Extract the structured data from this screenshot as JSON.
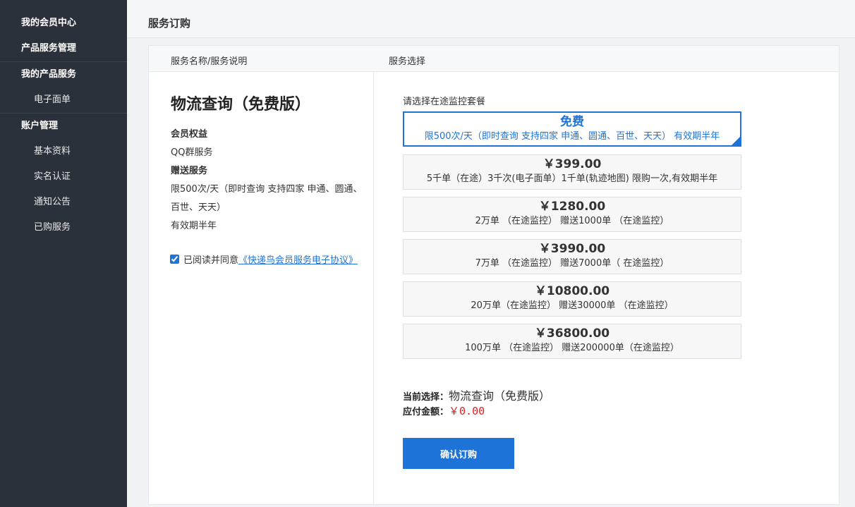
{
  "sidebar": {
    "items": [
      {
        "label": "我的会员中心",
        "level": "top"
      },
      {
        "label": "产品服务管理",
        "level": "top"
      },
      {
        "label": "我的产品服务",
        "level": "top"
      },
      {
        "label": "电子面单",
        "level": "sub"
      },
      {
        "label": "账户管理",
        "level": "top"
      },
      {
        "label": "基本资料",
        "level": "sub"
      },
      {
        "label": "实名认证",
        "level": "sub"
      },
      {
        "label": "通知公告",
        "level": "sub"
      },
      {
        "label": "已购服务",
        "level": "sub"
      }
    ]
  },
  "header": {
    "title": "服务订购"
  },
  "table": {
    "col1": "服务名称/服务说明",
    "col2": "服务选择"
  },
  "product": {
    "name": "物流查询（免费版）",
    "benefits_heading": "会员权益",
    "benefits": "QQ群服务",
    "gift_heading": "赠送服务",
    "gift_desc": "限500次/天（即时查询 支持四家 申通、圆通、百世、天天）",
    "validity": "有效期半年"
  },
  "agreement": {
    "checked": true,
    "prefix": "已阅读并同意",
    "link": "《快递鸟会员服务电子协议》"
  },
  "selection": {
    "label": "请选择在途监控套餐",
    "packages": [
      {
        "price": "免费",
        "desc": "限500次/天（即时查询 支持四家 申通、圆通、百世、天天） 有效期半年",
        "selected": true
      },
      {
        "price": "￥399.00",
        "desc": "5千单（在途）3千次(电子面单）1千单(轨迹地图) 限购一次,有效期半年",
        "selected": false
      },
      {
        "price": "￥1280.00",
        "desc": "2万单 （在途监控） 赠送1000单 （在途监控）",
        "selected": false
      },
      {
        "price": "￥3990.00",
        "desc": "7万单 （在途监控） 赠送7000单（ 在途监控）",
        "selected": false
      },
      {
        "price": "￥10800.00",
        "desc": "20万单（在途监控） 赠送30000单 （在途监控）",
        "selected": false
      },
      {
        "price": "￥36800.00",
        "desc": "100万单 （在途监控） 赠送200000单（在途监控）",
        "selected": false
      }
    ]
  },
  "summary": {
    "current_label": "当前选择：",
    "current_value": "物流查询（免费版）",
    "amount_label": "应付金额：",
    "amount_value": "￥0.00"
  },
  "confirm_label": "确认订购",
  "colors": {
    "sidebar_bg": "#2b313a",
    "accent": "#1e73d8",
    "price_red": "#e02020"
  }
}
